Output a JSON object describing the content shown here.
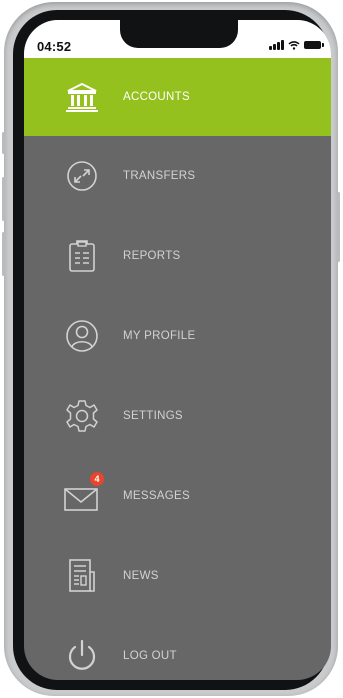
{
  "status_bar": {
    "time": "04:52",
    "signal_icon": "signal-bars-icon",
    "wifi_icon": "wifi-icon",
    "battery_icon": "battery-icon"
  },
  "colors": {
    "accent": "#95c11f",
    "menu_bg": "#676767",
    "badge": "#e8452c"
  },
  "menu": {
    "items": [
      {
        "label": "ACCOUNTS",
        "icon": "bank-icon",
        "active": true
      },
      {
        "label": "TRANSFERS",
        "icon": "transfer-arrows-icon",
        "active": false
      },
      {
        "label": "REPORTS",
        "icon": "clipboard-icon",
        "active": false
      },
      {
        "label": "MY PROFILE",
        "icon": "user-circle-icon",
        "active": false
      },
      {
        "label": "SETTINGS",
        "icon": "gear-icon",
        "active": false
      },
      {
        "label": "MESSAGES",
        "icon": "envelope-icon",
        "active": false,
        "badge": "4"
      },
      {
        "label": "NEWS",
        "icon": "newspaper-icon",
        "active": false
      },
      {
        "label": "LOG OUT",
        "icon": "power-icon",
        "active": false
      }
    ]
  }
}
